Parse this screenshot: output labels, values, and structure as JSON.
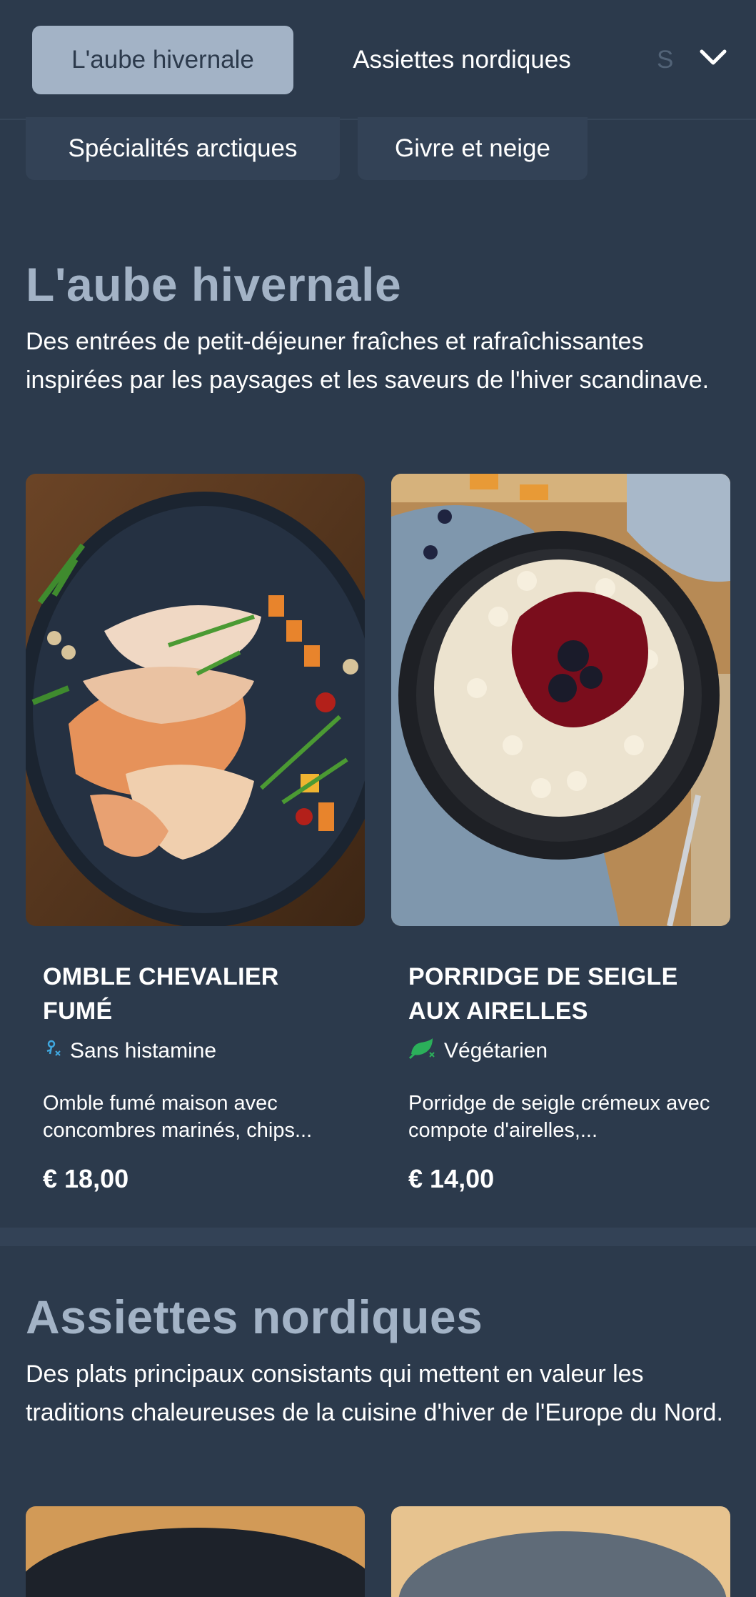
{
  "tabs": {
    "items": [
      "L'aube hivernale",
      "Assiettes nordiques",
      "S"
    ],
    "row2": [
      "Spécialités arctiques",
      "Givre et neige"
    ]
  },
  "sections": [
    {
      "title": "L'aube hivernale",
      "description": "Des entrées de petit-déjeuner fraîches et rafraîchissantes inspirées par les paysages et les saveurs de l'hiver scandinave.",
      "items": [
        {
          "name": "OMBLE CHEVALIER FUMÉ",
          "diet": "Sans histamine",
          "diet_icon": "histamine-free-icon",
          "description": "Omble fumé maison avec concombres marinés, chips...",
          "price": "€ 18,00"
        },
        {
          "name": "PORRIDGE DE SEIGLE AUX AIRELLES",
          "diet": "Végétarien",
          "diet_icon": "vegetarian-icon",
          "description": "Porridge de seigle crémeux avec compote d'airelles,...",
          "price": "€ 14,00"
        }
      ]
    },
    {
      "title": "Assiettes nordiques",
      "description": "Des plats principaux consistants qui mettent en valeur les traditions chaleureuses de la cuisine d'hiver de l'Europe du Nord."
    }
  ],
  "colors": {
    "background": "#2c3a4c",
    "active_tab": "#a3b3c6",
    "section_title": "#a3b3c6",
    "histamine_icon": "#3fa8e0",
    "vegetarian_icon": "#2bb05a"
  }
}
